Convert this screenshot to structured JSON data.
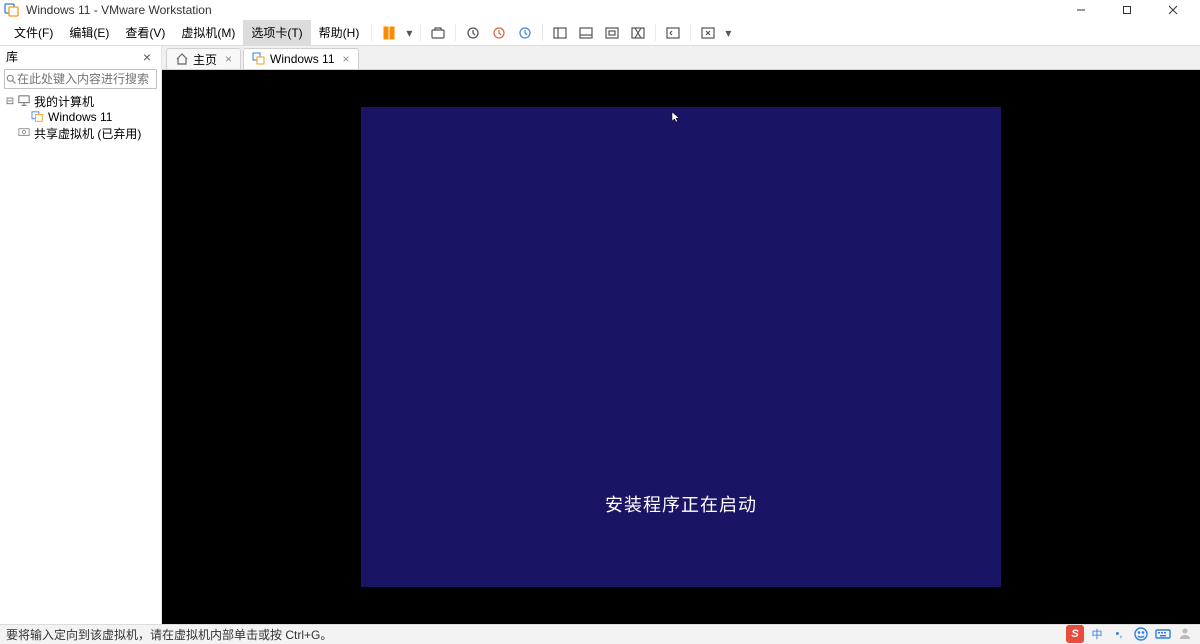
{
  "title": "Windows 11 - VMware Workstation",
  "menu": {
    "file": "文件(F)",
    "edit": "编辑(E)",
    "view": "查看(V)",
    "vm": "虚拟机(M)",
    "tabs": "选项卡(T)",
    "help": "帮助(H)"
  },
  "sidebar": {
    "title": "库",
    "search_placeholder": "在此处键入内容进行搜索",
    "nodes": {
      "root": "我的计算机",
      "vm": "Windows 11",
      "shared": "共享虚拟机 (已弃用)"
    }
  },
  "tabs": {
    "home": "主页",
    "vm": "Windows 11"
  },
  "vm_display": {
    "message": "安装程序正在启动"
  },
  "statusbar": {
    "hint": "要将输入定向到该虚拟机，请在虚拟机内部单击或按 Ctrl+G。"
  },
  "tray": {
    "ime_lang": "中",
    "ime_punct": "•,"
  }
}
